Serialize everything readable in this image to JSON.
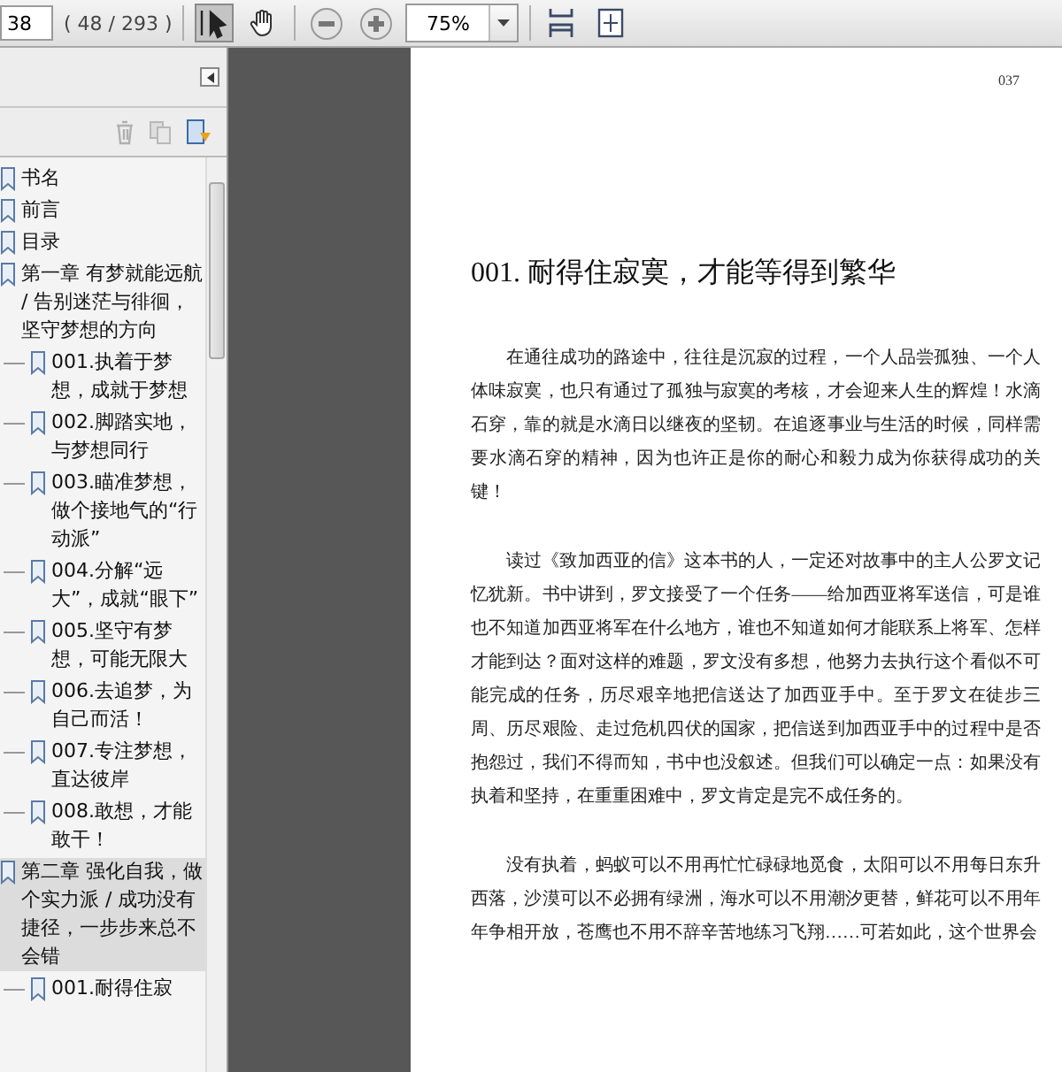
{
  "toolbar": {
    "page_input": "38",
    "page_count": "( 48 / 293 )",
    "tools": [
      {
        "kind": "select",
        "selected": true
      },
      {
        "kind": "hand",
        "selected": false
      }
    ],
    "zoom": "75%"
  },
  "bookmarks": [
    {
      "label": "书名",
      "selected": false
    },
    {
      "label": "前言",
      "selected": false
    },
    {
      "label": "目录",
      "selected": false
    },
    {
      "label": "第一章  有梦就能远航 / 告别迷茫与徘徊，坚守梦想的方向",
      "selected": false,
      "children": [
        {
          "label": "001.执着于梦想，成就于梦想",
          "selected": false
        },
        {
          "label": "002.脚踏实地，与梦想同行",
          "selected": false
        },
        {
          "label": "003.瞄准梦想，做个接地气的“行动派”",
          "selected": false
        },
        {
          "label": "004.分解“远大”，成就“眼下”",
          "selected": false
        },
        {
          "label": "005.坚守有梦想，可能无限大",
          "selected": false
        },
        {
          "label": "006.去追梦，为自己而活！",
          "selected": false
        },
        {
          "label": "007.专注梦想，直达彼岸",
          "selected": false
        },
        {
          "label": "008.敢想，才能敢干！",
          "selected": false
        }
      ]
    },
    {
      "label": "第二章  强化自我，做个实力派 / 成功没有捷径，一步步来总不会错",
      "selected": true,
      "children": [
        {
          "label": "001.耐得住寂",
          "selected": false
        }
      ]
    }
  ],
  "page": {
    "page_number": "037",
    "title": "001. 耐得住寂寞，才能等得到繁华",
    "paragraphs": [
      "在通往成功的路途中，往往是沉寂的过程，一个人品尝孤独、一个人体味寂寞，也只有通过了孤独与寂寞的考核，才会迎来人生的辉煌！水滴石穿，靠的就是水滴日以继夜的坚韧。在追逐事业与生活的时候，同样需要水滴石穿的精神，因为也许正是你的耐心和毅力成为你获得成功的关键！",
      "读过《致加西亚的信》这本书的人，一定还对故事中的主人公罗文记忆犹新。书中讲到，罗文接受了一个任务——给加西亚将军送信，可是谁也不知道加西亚将军在什么地方，谁也不知道如何才能联系上将军、怎样才能到达？面对这样的难题，罗文没有多想，他努力去执行这个看似不可能完成的任务，历尽艰辛地把信送达了加西亚手中。至于罗文在徒步三周、历尽艰险、走过危机四伏的国家，把信送到加西亚手中的过程中是否抱怨过，我们不得而知，书中也没叙述。但我们可以确定一点：如果没有执着和坚持，在重重困难中，罗文肯定是完不成任务的。",
      "没有执着，蚂蚁可以不用再忙忙碌碌地觅食，太阳可以不用每日东升西落，沙漠可以不必拥有绿洲，海水可以不用潮汐更替，鲜花可以不用年年争相开放，苍鹰也不用不辞辛苦地练习飞翔……可若如此，这个世界会"
    ]
  }
}
